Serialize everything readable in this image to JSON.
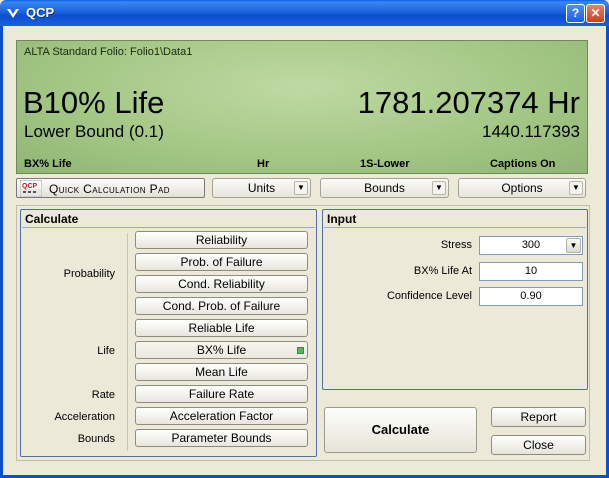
{
  "window": {
    "title": "QCP",
    "help_glyph": "?",
    "close_glyph": "✕"
  },
  "display": {
    "source": "ALTA Standard Folio: Folio1\\Data1",
    "metric": "B10% Life",
    "value": "1781.207374 Hr",
    "bound_label": "Lower Bound (0.1)",
    "bound_value": "1440.117393",
    "footer": [
      "BX% Life",
      "Hr",
      "1S-Lower",
      "Captions On"
    ]
  },
  "toolbar": {
    "qcp_logo": "QCP",
    "qcp_label": "Quick Calculation Pad",
    "units": "Units",
    "bounds": "Bounds",
    "options": "Options"
  },
  "calculate": {
    "title": "Calculate",
    "labels": {
      "probability": "Probability",
      "life": "Life",
      "rate": "Rate",
      "acceleration": "Acceleration",
      "bounds": "Bounds"
    },
    "buttons": [
      "Reliability",
      "Prob. of Failure",
      "Cond. Reliability",
      "Cond. Prob. of Failure",
      "Reliable Life",
      "BX% Life",
      "Mean Life",
      "Failure Rate",
      "Acceleration Factor",
      "Parameter Bounds"
    ]
  },
  "input": {
    "title": "Input",
    "stress_label": "Stress",
    "stress_value": "300",
    "bx_label": "BX% Life At",
    "bx_value": "10",
    "conf_label": "Confidence Level",
    "conf_value": "0.90"
  },
  "actions": {
    "calculate": "Calculate",
    "report": "Report",
    "close": "Close"
  },
  "colors": {
    "title_bar": "#0a4fd0",
    "lcd": "#a5c886",
    "active_led": "#4fba5a"
  }
}
